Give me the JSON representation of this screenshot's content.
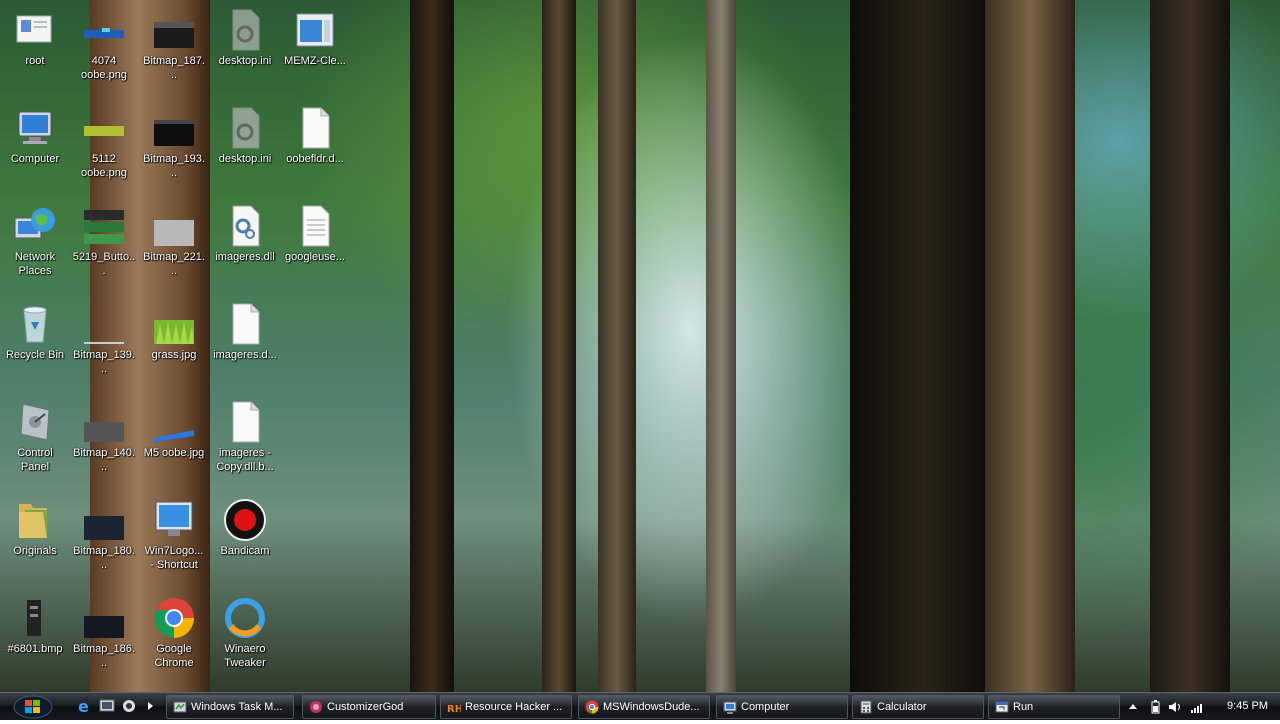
{
  "desktop": {
    "icons": [
      {
        "label": "root",
        "icon": "user-folder-icon"
      },
      {
        "label": "Computer",
        "icon": "computer-icon"
      },
      {
        "label": "Network Places",
        "icon": "network-globe-icon"
      },
      {
        "label": "Recycle Bin",
        "icon": "recycle-bin-icon"
      },
      {
        "label": "Control Panel",
        "icon": "control-panel-icon"
      },
      {
        "label": "Originals",
        "icon": "folder-icon"
      },
      {
        "label": "#6801.bmp",
        "icon": "bitmap-file-icon"
      },
      {
        "label": "4074 oobe.png",
        "icon": "image-file-icon"
      },
      {
        "label": "5112 oobe.png",
        "icon": "image-file-icon"
      },
      {
        "label": "5219_Butto...",
        "icon": "start-buttons-image-icon"
      },
      {
        "label": "Bitmap_139...",
        "icon": "bitmap-file-icon"
      },
      {
        "label": "Bitmap_140...",
        "icon": "bitmap-file-icon"
      },
      {
        "label": "Bitmap_180...",
        "icon": "bitmap-file-icon"
      },
      {
        "label": "Bitmap_186...",
        "icon": "bitmap-file-icon"
      },
      {
        "label": "Bitmap_187...",
        "icon": "bitmap-file-icon"
      },
      {
        "label": "Bitmap_193...",
        "icon": "bitmap-file-icon"
      },
      {
        "label": "Bitmap_221...",
        "icon": "bitmap-file-icon"
      },
      {
        "label": "grass.jpg",
        "icon": "grass-image-icon"
      },
      {
        "label": "M5 oobe.jpg",
        "icon": "image-file-icon"
      },
      {
        "label": "Win7Logo... - Shortcut",
        "icon": "monitor-shortcut-icon"
      },
      {
        "label": "Google Chrome",
        "icon": "chrome-icon"
      },
      {
        "label": "desktop.ini",
        "icon": "settings-file-icon"
      },
      {
        "label": "desktop.ini",
        "icon": "settings-file-icon"
      },
      {
        "label": "imageres.dll",
        "icon": "dll-file-icon"
      },
      {
        "label": "imageres.d...",
        "icon": "blank-file-icon"
      },
      {
        "label": "imageres - Copy.dll.b...",
        "icon": "blank-file-icon"
      },
      {
        "label": "Bandicam",
        "icon": "bandicam-icon"
      },
      {
        "label": "Winaero Tweaker",
        "icon": "winaero-icon"
      },
      {
        "label": "MEMZ-Cle...",
        "icon": "app-window-icon"
      },
      {
        "label": "oobefldr.d...",
        "icon": "blank-file-icon"
      },
      {
        "label": "googleuse...",
        "icon": "text-file-icon"
      }
    ]
  },
  "taskbar": {
    "buttons": [
      {
        "label": "Windows Task M...",
        "icon": "task-manager-icon"
      },
      {
        "label": "CustomizerGod",
        "icon": "customizergod-icon"
      },
      {
        "label": "Resource Hacker ...",
        "icon": "resource-hacker-icon"
      },
      {
        "label": "MSWindowsDude...",
        "icon": "chrome-icon"
      },
      {
        "label": "Computer",
        "icon": "computer-icon"
      },
      {
        "label": "Calculator",
        "icon": "calculator-icon"
      },
      {
        "label": "Run",
        "icon": "run-icon"
      }
    ],
    "clock": "9:45 PM"
  },
  "colors": {
    "taskbar": "#16191d",
    "label_text": "#ffffff",
    "accent": "#3a8ee6"
  }
}
